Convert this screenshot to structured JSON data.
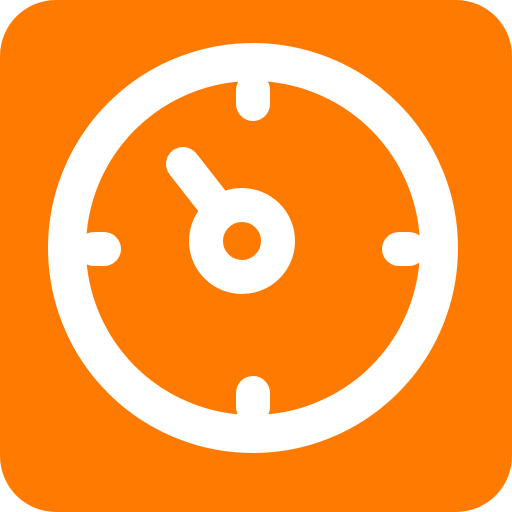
{
  "icon": {
    "name": "stopwatch-gauge-icon",
    "background_color": "#FF7A00",
    "foreground_color": "#FFFFFF"
  }
}
